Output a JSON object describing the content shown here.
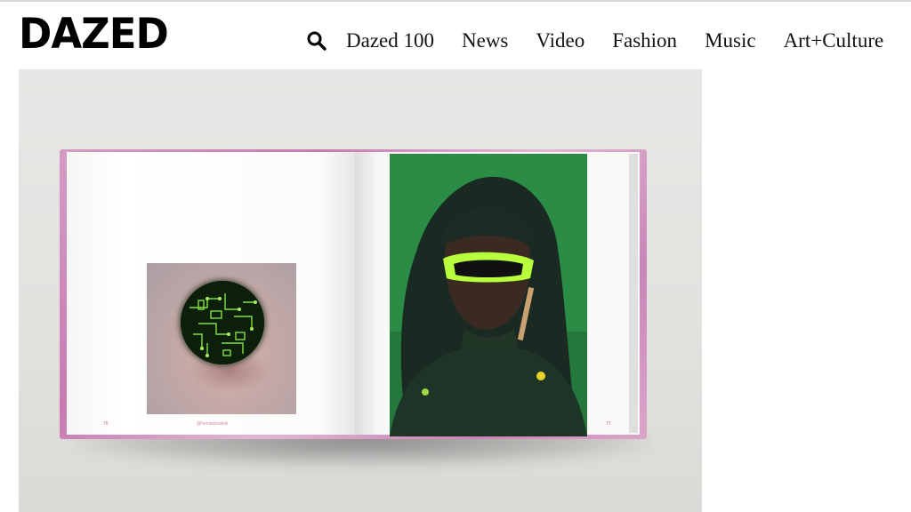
{
  "header": {
    "logo": "DAZED",
    "nav": [
      "Dazed 100",
      "News",
      "Video",
      "Fashion",
      "Music",
      "Art+Culture"
    ]
  },
  "icons": {
    "search": "search-icon"
  },
  "colors": {
    "brand": "#000000",
    "background": "#ffffff",
    "cover_pink": "#c77bb2",
    "photo_green": "#2a8a44"
  },
  "hero": {
    "left_page_number": "76",
    "left_caption": "@hemaxbowlsk",
    "right_page_number": "77"
  }
}
